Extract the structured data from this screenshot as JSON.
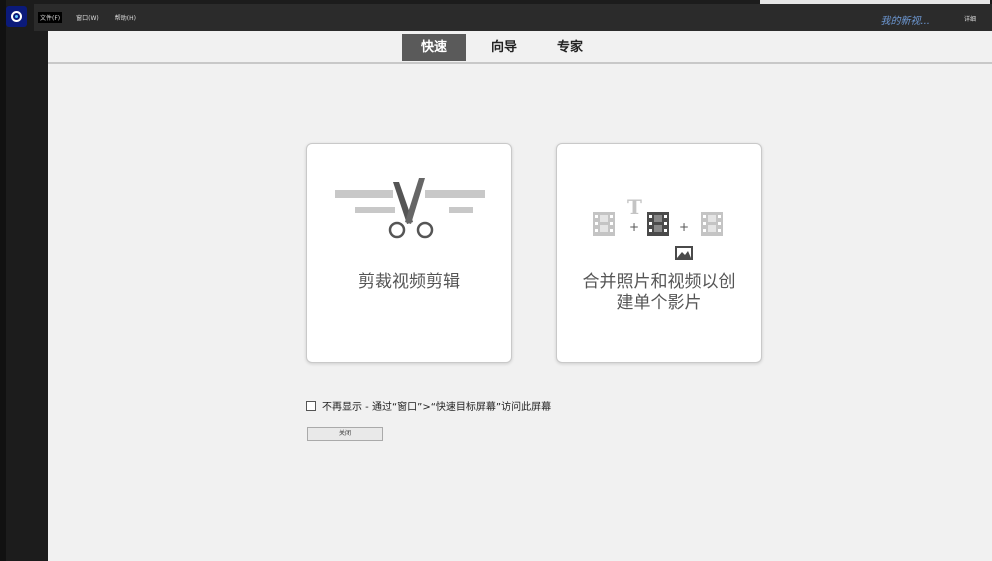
{
  "menubar": {
    "items": [
      "文件(F)",
      "窗口(W)",
      "帮助(H)"
    ],
    "project_title": "我的新视...",
    "detail_label": "详细"
  },
  "modes": {
    "tabs": [
      "快速",
      "向导",
      "专家"
    ],
    "active_tab": "快速"
  },
  "cards": {
    "trim": {
      "label": "剪裁视频剪辑",
      "icon": "scissors-icon"
    },
    "combine": {
      "label_line1": "合并照片和视频以创",
      "label_line2": "建单个影片",
      "icon": "combine-media-icon"
    }
  },
  "footer": {
    "dont_show_text": "不再显示 - 通过“窗口”>“快速目标屏幕”访问此屏幕",
    "close_label": "关闭"
  },
  "colors": {
    "accent_tab": "#5a5a5a",
    "project_title": "#6f9bd8",
    "app_logo": "#0b1a7a"
  }
}
